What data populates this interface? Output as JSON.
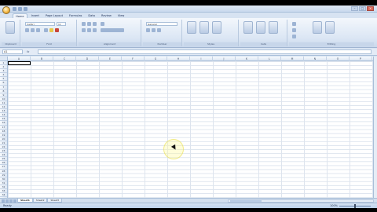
{
  "window": {
    "title": "",
    "controls": [
      "–",
      "□",
      "×"
    ]
  },
  "ribbon_tabs": [
    "Home",
    "Insert",
    "Page Layout",
    "Formulas",
    "Data",
    "Review",
    "View"
  ],
  "active_tab_index": 0,
  "ribbon": {
    "font_name": "Calibri",
    "font_size": "11",
    "number_format": "General",
    "groups": [
      "Clipboard",
      "Font",
      "Alignment",
      "Number",
      "Styles",
      "Cells",
      "Editing"
    ]
  },
  "formula_bar": {
    "name_box": "A1",
    "fx_label": "fx",
    "value": ""
  },
  "grid": {
    "columns": [
      "A",
      "B",
      "C",
      "D",
      "E",
      "F",
      "G",
      "H",
      "I",
      "J",
      "K",
      "L",
      "M",
      "N",
      "O",
      "P"
    ],
    "rows": [
      "1",
      "2",
      "3",
      "4",
      "5",
      "6",
      "7",
      "8",
      "9",
      "10",
      "11",
      "12",
      "13",
      "14",
      "15",
      "16",
      "17",
      "18",
      "19",
      "20",
      "21",
      "22",
      "23",
      "24",
      "25",
      "26",
      "27",
      "28",
      "29",
      "30",
      "31",
      "32",
      "33",
      "34"
    ]
  },
  "sheets": [
    "Sheet1",
    "Sheet2",
    "Sheet3"
  ],
  "active_sheet_index": 0,
  "status": {
    "text": "Ready",
    "zoom": "100%"
  },
  "colors": {
    "ribbon_bg": "#dbe6f4",
    "grid_line": "#dde4ee",
    "office_orb": "#f2b33d"
  },
  "icons": [
    "office-button-icon",
    "save-icon",
    "undo-icon",
    "redo-icon",
    "cursor-icon"
  ]
}
